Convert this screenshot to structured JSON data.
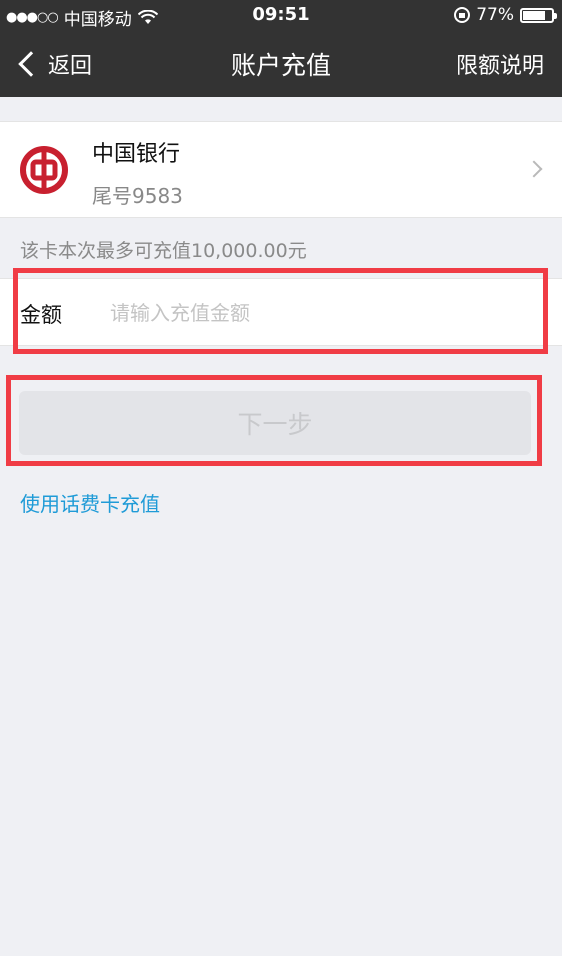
{
  "status_bar": {
    "signal": "●●●○○",
    "carrier": "中国移动",
    "time": "09:51",
    "battery_percent": "77%",
    "battery_level": 0.77
  },
  "nav": {
    "back_label": "返回",
    "title": "账户充值",
    "right_label": "限额说明"
  },
  "bank_card": {
    "name": "中国银行",
    "tail": "尾号9583",
    "brand_color": "#c8202f"
  },
  "limit_hint": "该卡本次最多可充值10,000.00元",
  "amount": {
    "label": "金额",
    "placeholder": "请输入充值金额",
    "value": ""
  },
  "next_button": {
    "label": "下一步"
  },
  "phone_card_link": "使用话费卡充值",
  "colors": {
    "nav_bg": "#333333",
    "page_bg": "#eff0f4",
    "link": "#1f9bd7",
    "highlight": "#f03c45"
  }
}
